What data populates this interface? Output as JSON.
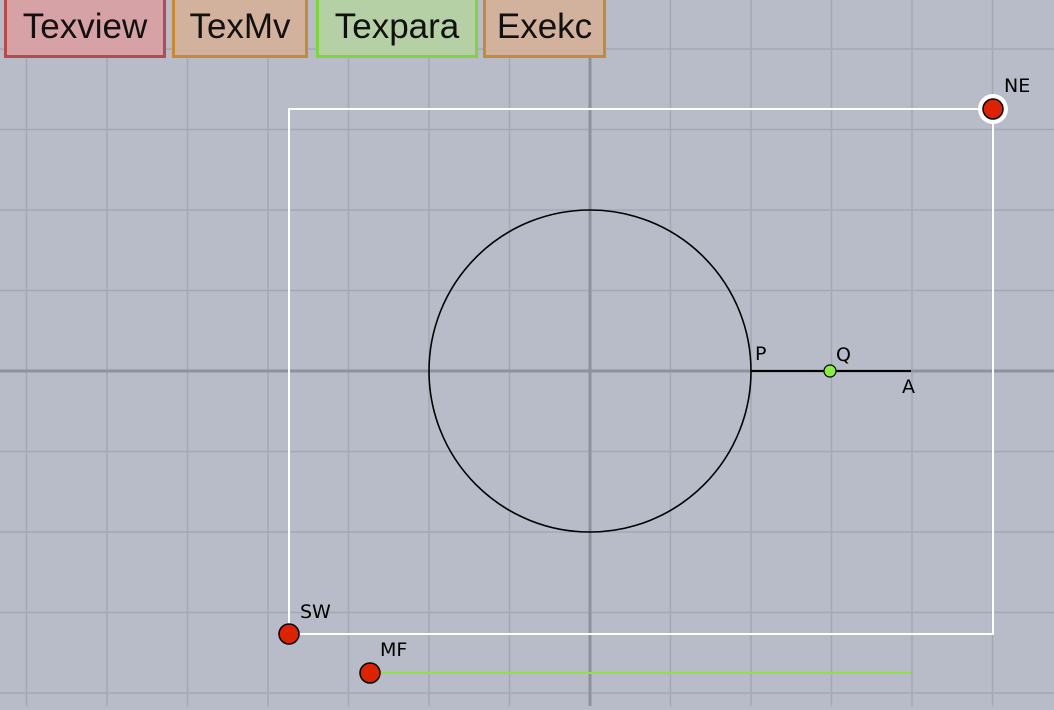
{
  "toolbar": {
    "buttons": [
      {
        "label": "Texview",
        "bg": "#d6a2a6",
        "border": "#b84a4e"
      },
      {
        "label": "TexMv",
        "bg": "#d2b29c",
        "border": "#c9892f"
      },
      {
        "label": "Texpara",
        "bg": "#b6d0a6",
        "border": "#7fd63a"
      },
      {
        "label": "Exekc",
        "bg": "#d2b29c",
        "border": "#c9892f"
      }
    ]
  },
  "canvas": {
    "background": "#b8bcc9",
    "grid_color": "#a4a8b4",
    "axis_color": "#8e929c",
    "frame_color": "#ffffff",
    "circle_color": "#000000",
    "slider_color": "#90e04a",
    "free_point_color": "#dd2200",
    "slider_point_color": "#88ee44"
  },
  "points": {
    "ne": "NE",
    "sw": "SW",
    "mf": "MF",
    "p": "P",
    "q": "Q",
    "a": "A"
  }
}
